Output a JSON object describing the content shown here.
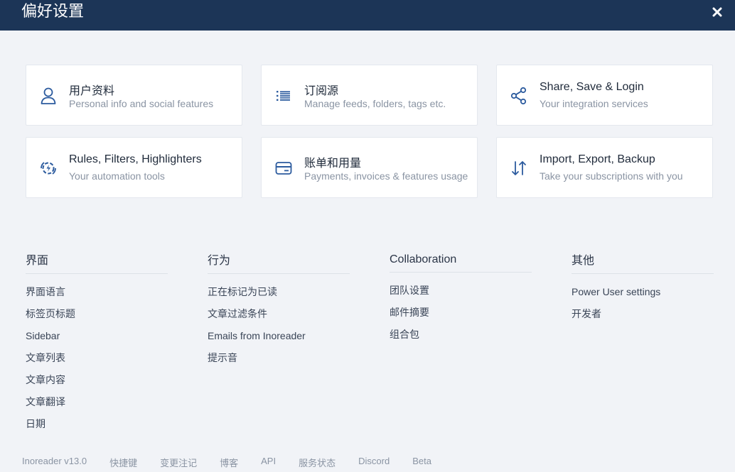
{
  "header": {
    "title": "偏好设置",
    "close_icon": "close-icon"
  },
  "colors": {
    "header_bg": "#1c3557",
    "accent": "#2c5b9e",
    "page_bg": "#f1f3f7"
  },
  "cards": [
    {
      "title": "用户资料",
      "subtitle": "Personal info and social features",
      "icon": "user-icon"
    },
    {
      "title": "订阅源",
      "subtitle": "Manage feeds, folders, tags etc.",
      "icon": "list-icon"
    },
    {
      "title": "Share, Save & Login",
      "subtitle": "Your integration services",
      "icon": "share-icon"
    },
    {
      "title": "Rules, Filters, Highlighters",
      "subtitle": "Your automation tools",
      "icon": "automation-icon"
    },
    {
      "title": "账单和用量",
      "subtitle": "Payments, invoices & features usage",
      "icon": "card-icon"
    },
    {
      "title": "Import, Export, Backup",
      "subtitle": "Take your subscriptions with you",
      "icon": "import-export-icon"
    }
  ],
  "sections": [
    {
      "heading": "界面",
      "items": [
        "界面语言",
        "标签页标题",
        "Sidebar",
        "文章列表",
        "文章内容",
        "文章翻译",
        "日期"
      ]
    },
    {
      "heading": "行为",
      "items": [
        "正在标记为已读",
        "文章过滤条件",
        "Emails from Inoreader",
        "提示音"
      ]
    },
    {
      "heading": "Collaboration",
      "items": [
        "团队设置",
        "邮件摘要",
        "组合包"
      ]
    },
    {
      "heading": "其他",
      "items": [
        "Power User settings",
        "开发者"
      ]
    }
  ],
  "footer": {
    "version": "Inoreader v13.0",
    "links": [
      "快捷键",
      "变更注记",
      "博客",
      "API",
      "服务状态",
      "Discord",
      "Beta"
    ]
  }
}
